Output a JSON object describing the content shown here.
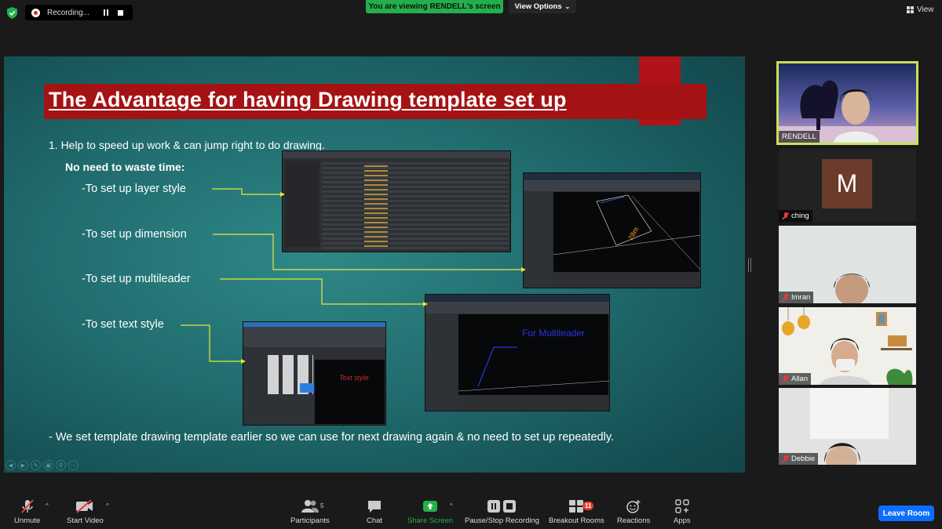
{
  "top_bar": {
    "recording_label": "Recording...",
    "viewing_banner": "You are viewing RENDELL's screen",
    "view_options_label": "View Options",
    "view_label": "View"
  },
  "slide": {
    "title": "The Advantage for having Drawing template set up",
    "point_1": "1. Help to speed up work & can jump right to do drawing.",
    "sub_heading": "No need to waste time:",
    "bullets": [
      "-To set up layer style",
      "-To set up dimension",
      "-To set up multileader",
      "-To set text style"
    ],
    "note": "- We set template drawing template earlier so we can use for next drawing again & no need to set up repeatedly.",
    "screenshot_multileader_text": "For Multileader",
    "screenshot_textstyle_text": "Text style",
    "screenshot_dimension_text": "28m"
  },
  "participants": [
    {
      "name": "RENDELL",
      "active_speaker": true
    },
    {
      "name": "ching",
      "avatar_letter": "M",
      "muted": true
    },
    {
      "name": "Imran",
      "muted": true
    },
    {
      "name": "Allan",
      "muted": true
    },
    {
      "name": "Debbie",
      "muted": true
    }
  ],
  "toolbar": {
    "unmute": "Unmute",
    "start_video": "Start Video",
    "participants": "Participants",
    "participants_count": "5",
    "chat": "Chat",
    "share_screen": "Share Screen",
    "pause_stop_recording": "Pause/Stop Recording",
    "breakout_rooms": "Breakout Rooms",
    "breakout_badge": "11",
    "reactions": "Reactions",
    "apps": "Apps",
    "leave_room": "Leave Room"
  },
  "colors": {
    "accent_green": "#23b04c",
    "speaker_border": "#c7e15a",
    "slide_title_bar": "#a51214",
    "leave_button": "#0d6efd",
    "muted_red": "#e23b3b"
  }
}
